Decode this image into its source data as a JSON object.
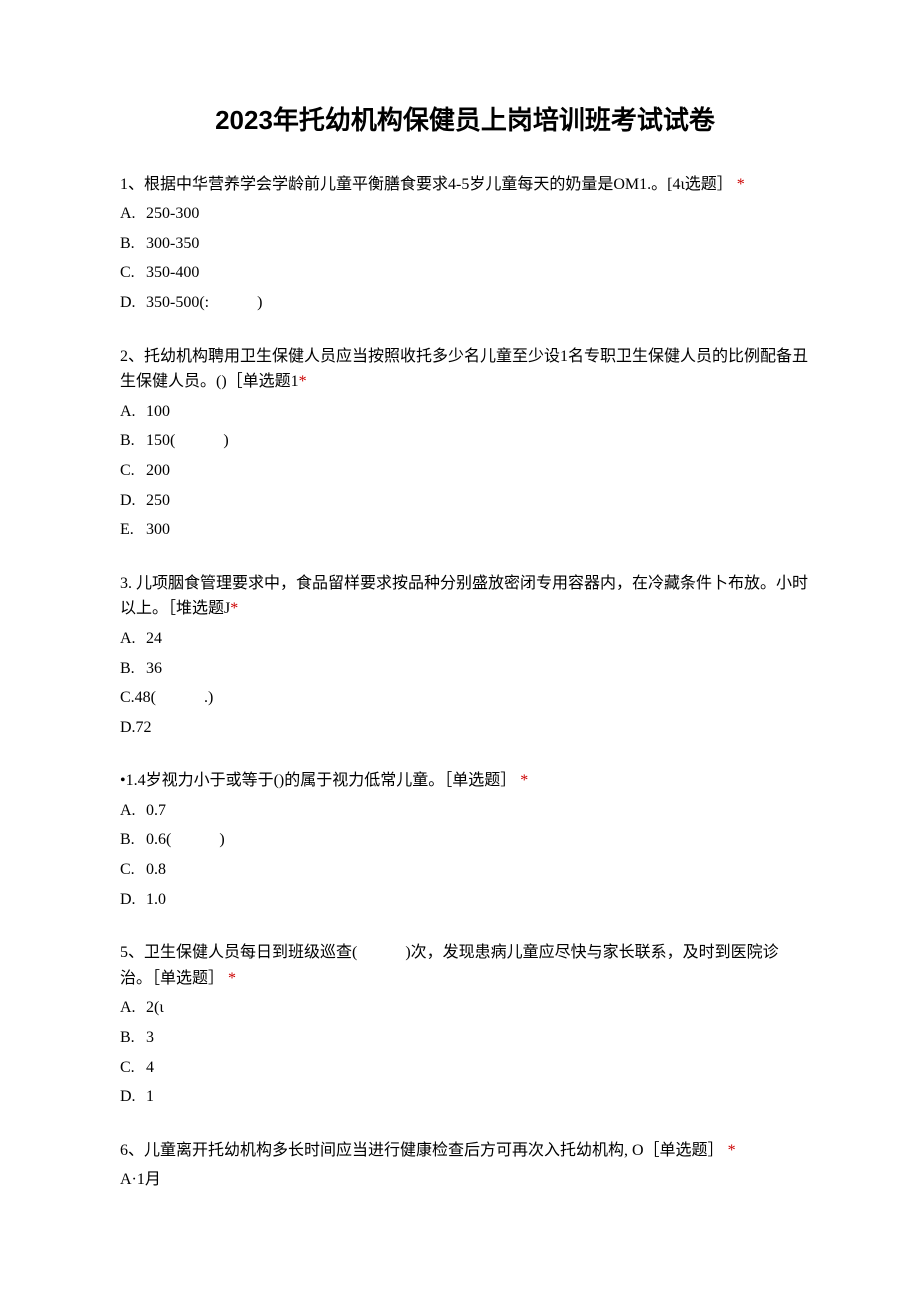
{
  "title": "2023年托幼机构保健员上岗培训班考试试卷",
  "q1": {
    "text": "1、根据中华营养学会学龄前儿童平衡膳食要求4-5岁儿童每天的奶量是OM1.。[4ι选题］",
    "a": "250-300",
    "b": "300-350",
    "c": "350-400",
    "d": "350-500(:   )"
  },
  "q2": {
    "text": "2、托幼机构聘用卫生保健人员应当按照收托多少名儿童至少设1名专职卫生保健人员的比例配备丑生保健人员。()［单选题1",
    "a": "100",
    "b": "150(   )",
    "c": "200",
    "d": "250",
    "e": "300"
  },
  "q3": {
    "text": "3.  儿项胭食管理要求中，食品留样要求按品种分别盛放密闭专用容器内，在冷藏条件卜布放。小时以上。［堆选题J",
    "a": "24",
    "b": "36",
    "c": "C.48(   .)",
    "d": "D.72"
  },
  "q4": {
    "text": "•1.4岁视力小于或等于()的属于视力低常儿童。［单选题］",
    "a": "0.7",
    "b": "0.6(   )",
    "c": "0.8",
    "d": "1.0"
  },
  "q5": {
    "text": "5、卫生保健人员每日到班级巡查(   )次，发现患病儿童应尽快与家长联系，及时到医院诊治。［单选题］",
    "a": "2(ι",
    "b": "3",
    "c": "4",
    "d": "1"
  },
  "q6": {
    "text": "6、儿童离开托幼机构多长时间应当进行健康检查后方可再次入托幼机构, O［单选题］",
    "a": "A·1月"
  },
  "labels": {
    "A": "A.",
    "B": "B.",
    "C": "C.",
    "D": "D.",
    "E": "E."
  },
  "star": "*"
}
